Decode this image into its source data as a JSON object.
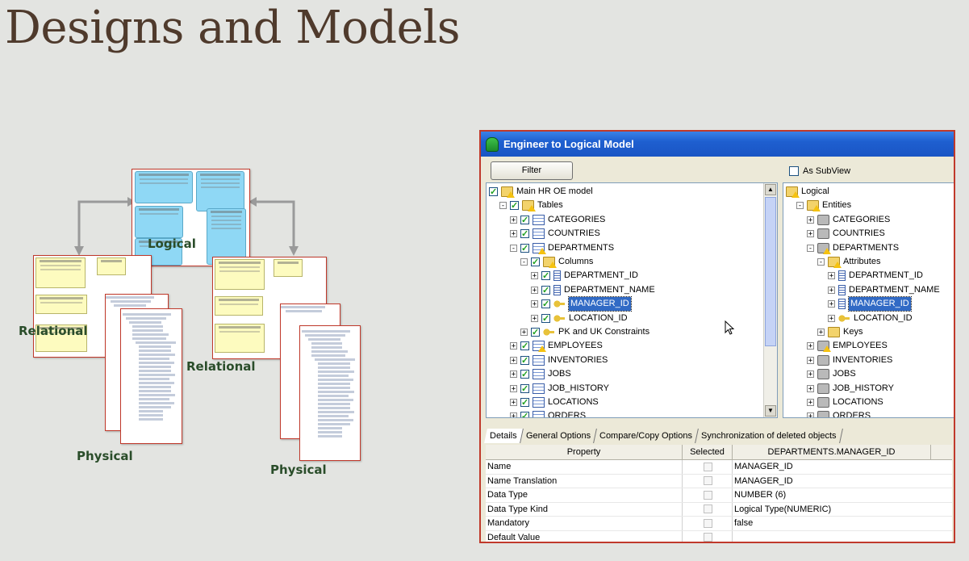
{
  "slide": {
    "title": "Designs and Models"
  },
  "diagram": {
    "logical_label": "Logical",
    "relational_left_label": "Relational",
    "relational_right_label": "Relational",
    "physical_left_label": "Physical",
    "physical_right_label": "Physical"
  },
  "dialog": {
    "title": "Engineer to Logical Model",
    "filter_label": "Filter",
    "subview_label": "As SubView",
    "left_tree": [
      {
        "label": "Main HR OE model",
        "icon": "folder-warn",
        "level": 0,
        "expander": "",
        "checked": true
      },
      {
        "label": "Tables",
        "icon": "folder-warn",
        "level": 1,
        "expander": "-",
        "checked": true
      },
      {
        "label": "CATEGORIES",
        "icon": "table",
        "level": 2,
        "expander": "+",
        "checked": true
      },
      {
        "label": "COUNTRIES",
        "icon": "table",
        "level": 2,
        "expander": "+",
        "checked": true
      },
      {
        "label": "DEPARTMENTS",
        "icon": "table-warn",
        "level": 2,
        "expander": "-",
        "checked": true
      },
      {
        "label": "Columns",
        "icon": "folder-warn",
        "level": 3,
        "expander": "-",
        "checked": true
      },
      {
        "label": "DEPARTMENT_ID",
        "icon": "column",
        "level": 4,
        "expander": "+",
        "checked": true
      },
      {
        "label": "DEPARTMENT_NAME",
        "icon": "column",
        "level": 4,
        "expander": "+",
        "checked": true
      },
      {
        "label": "MANAGER_ID",
        "icon": "key",
        "level": 4,
        "expander": "+",
        "checked": true,
        "selected": true
      },
      {
        "label": "LOCATION_ID",
        "icon": "key",
        "level": 4,
        "expander": "+",
        "checked": true
      },
      {
        "label": "PK and UK Constraints",
        "icon": "key",
        "level": 3,
        "expander": "+",
        "checked": true
      },
      {
        "label": "EMPLOYEES",
        "icon": "table-warn",
        "level": 2,
        "expander": "+",
        "checked": true
      },
      {
        "label": "INVENTORIES",
        "icon": "table",
        "level": 2,
        "expander": "+",
        "checked": true
      },
      {
        "label": "JOBS",
        "icon": "table",
        "level": 2,
        "expander": "+",
        "checked": true
      },
      {
        "label": "JOB_HISTORY",
        "icon": "table",
        "level": 2,
        "expander": "+",
        "checked": true
      },
      {
        "label": "LOCATIONS",
        "icon": "table",
        "level": 2,
        "expander": "+",
        "checked": true
      },
      {
        "label": "ORDERS",
        "icon": "table",
        "level": 2,
        "expander": "+",
        "checked": true
      }
    ],
    "right_tree": [
      {
        "label": "Logical",
        "icon": "folder-warn",
        "level": 0,
        "expander": ""
      },
      {
        "label": "Entities",
        "icon": "folder-warn",
        "level": 1,
        "expander": "-"
      },
      {
        "label": "CATEGORIES",
        "icon": "entity",
        "level": 2,
        "expander": "+"
      },
      {
        "label": "COUNTRIES",
        "icon": "entity",
        "level": 2,
        "expander": "+"
      },
      {
        "label": "DEPARTMENTS",
        "icon": "entity-warn",
        "level": 2,
        "expander": "-"
      },
      {
        "label": "Attributes",
        "icon": "folder-warn",
        "level": 3,
        "expander": "-"
      },
      {
        "label": "DEPARTMENT_ID",
        "icon": "column",
        "level": 4,
        "expander": "+"
      },
      {
        "label": "DEPARTMENT_NAME",
        "icon": "column",
        "level": 4,
        "expander": "+"
      },
      {
        "label": "MANAGER_ID",
        "icon": "column",
        "level": 4,
        "expander": "+",
        "selected": true
      },
      {
        "label": "LOCATION_ID",
        "icon": "key",
        "level": 4,
        "expander": "+"
      },
      {
        "label": "Keys",
        "icon": "folder",
        "level": 3,
        "expander": "+"
      },
      {
        "label": "EMPLOYEES",
        "icon": "entity-warn",
        "level": 2,
        "expander": "+"
      },
      {
        "label": "INVENTORIES",
        "icon": "entity",
        "level": 2,
        "expander": "+"
      },
      {
        "label": "JOBS",
        "icon": "entity",
        "level": 2,
        "expander": "+"
      },
      {
        "label": "JOB_HISTORY",
        "icon": "entity",
        "level": 2,
        "expander": "+"
      },
      {
        "label": "LOCATIONS",
        "icon": "entity",
        "level": 2,
        "expander": "+"
      },
      {
        "label": "ORDERS",
        "icon": "entity",
        "level": 2,
        "expander": "+"
      }
    ],
    "tabs": [
      "Details",
      "General Options",
      "Compare/Copy Options",
      "Synchronization of deleted objects"
    ],
    "grid": {
      "headers": [
        "Property",
        "Selected",
        "DEPARTMENTS.MANAGER_ID"
      ],
      "rows": [
        {
          "property": "Name",
          "value": "MANAGER_ID"
        },
        {
          "property": "Name Translation",
          "value": "MANAGER_ID"
        },
        {
          "property": "Data Type",
          "value": "NUMBER (6)"
        },
        {
          "property": "Data Type Kind",
          "value": "Logical Type(NUMERIC)"
        },
        {
          "property": "Mandatory",
          "value": "false"
        },
        {
          "property": "Default Value",
          "value": ""
        }
      ]
    }
  }
}
